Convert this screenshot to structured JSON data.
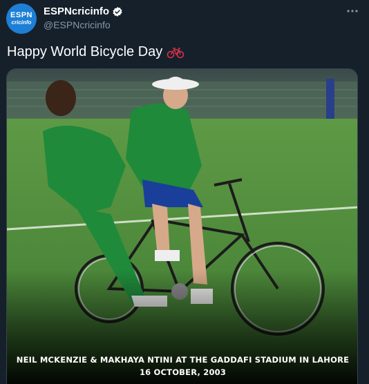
{
  "account": {
    "avatar_line1": "ESPN",
    "avatar_line2": "cricinfo",
    "display_name": "ESPNcricinfo",
    "handle": "@ESPNcricinfo",
    "verified": true
  },
  "icons": {
    "verified": "verified-badge-icon",
    "more": "more-options-icon",
    "emoji": "bicycle-emoji-icon"
  },
  "tweet": {
    "text": "Happy World Bicycle Day"
  },
  "media": {
    "caption_line1": "NEIL MCKENZIE & MAKHAYA NTINI AT THE GADDAFI STADIUM IN LAHORE",
    "caption_line2": "16 OCTOBER, 2003"
  },
  "colors": {
    "background": "#15202b",
    "secondary_text": "#8899a6",
    "jersey_green": "#1f8a3a",
    "grass": "#4f8a3c"
  }
}
